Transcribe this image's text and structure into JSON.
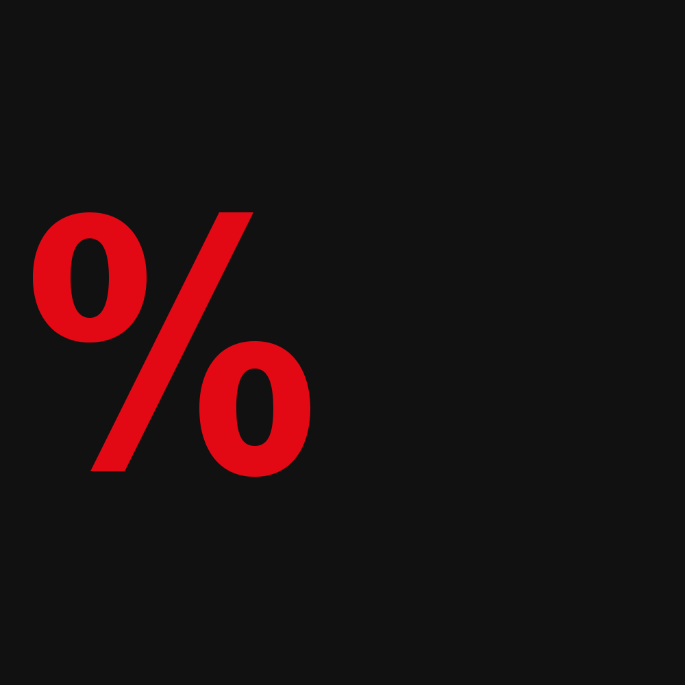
{
  "symbol": {
    "text": "%",
    "color": "#E30914"
  },
  "background_color": "#111111"
}
